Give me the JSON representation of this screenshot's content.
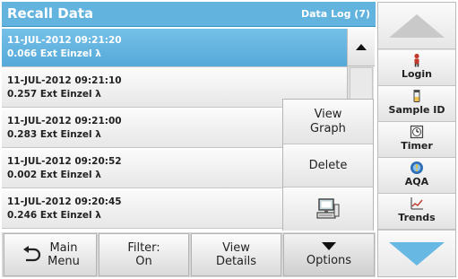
{
  "header": {
    "title": "Recall Data",
    "right_label": "Data Log (7)"
  },
  "rows": [
    {
      "line1": "11-JUL-2012  09:21:20",
      "line2": "0.066  Ext  Einzel λ",
      "selected": true
    },
    {
      "line1": "11-JUL-2012  09:21:10",
      "line2": "0.257  Ext  Einzel λ",
      "selected": false
    },
    {
      "line1": "11-JUL-2012  09:21:00",
      "line2": "0.283  Ext  Einzel λ",
      "selected": false
    },
    {
      "line1": "11-JUL-2012  09:20:52",
      "line2": "0.002  Ext  Einzel λ",
      "selected": false
    },
    {
      "line1": "11-JUL-2012  09:20:45",
      "line2": "0.246  Ext  Einzel λ",
      "selected": false
    }
  ],
  "popup": {
    "view_graph": {
      "line1": "View",
      "line2": "Graph"
    },
    "delete": "Delete",
    "export_icon": "computer-icon"
  },
  "bottom": {
    "main_menu": {
      "line1": "Main",
      "line2": "Menu",
      "icon": "back-arrow-icon"
    },
    "filter": {
      "line1": "Filter:",
      "line2": "On"
    },
    "view_details": {
      "line1": "View",
      "line2": "Details"
    },
    "options": {
      "label": "Options",
      "icon": "triangle-down-icon"
    }
  },
  "side": {
    "login": {
      "label": "Login",
      "icon": "person-icon"
    },
    "sample_id": {
      "label": "Sample ID",
      "icon": "sample-vial-icon"
    },
    "timer": {
      "label": "Timer",
      "icon": "timer-icon"
    },
    "aqa": {
      "label": "AQA",
      "icon": "aqa-icon"
    },
    "trends": {
      "label": "Trends",
      "icon": "trend-graph-icon"
    }
  },
  "colors": {
    "header": "#63b3df",
    "selected_row": "#5fb2e0",
    "nav_arrow": "#67b8e3"
  }
}
